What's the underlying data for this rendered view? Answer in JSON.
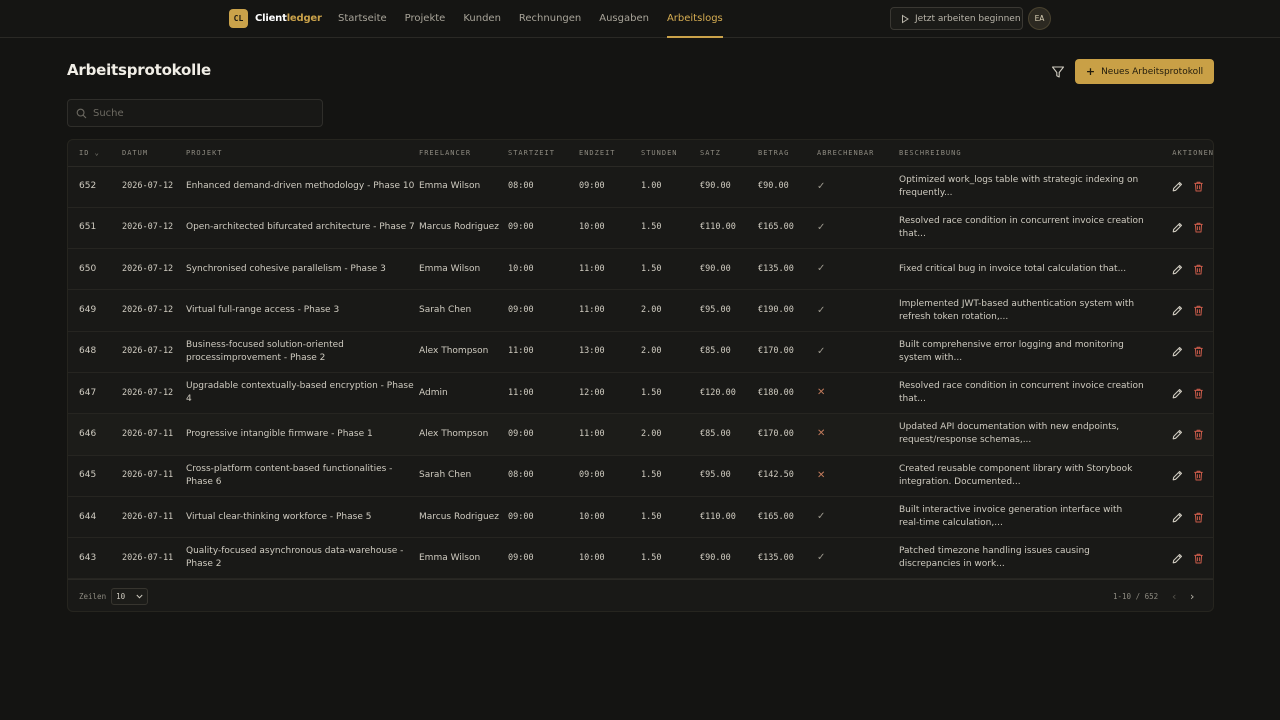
{
  "app": {
    "logo_mark": "CL",
    "name_part1": "Client",
    "name_part2": "ledger"
  },
  "nav": [
    "Startseite",
    "Projekte",
    "Kunden",
    "Rechnungen",
    "Ausgaben",
    "Arbeitslogs"
  ],
  "nav_active": "Arbeitslogs",
  "header": {
    "work_button": "Jetzt arbeiten beginnen",
    "avatar": "EA"
  },
  "page": {
    "title": "Arbeitsprotokolle",
    "new_button": "Neues Arbeitsprotokoll",
    "search_placeholder": "Suche"
  },
  "table": {
    "columns": [
      "ID",
      "DATUM",
      "PROJEKT",
      "FREELANCER",
      "STARTZEIT",
      "ENDZEIT",
      "STUNDEN",
      "SATZ",
      "BETRAG",
      "ABRECHENBAR",
      "BESCHREIBUNG",
      "AKTIONEN"
    ],
    "rows": [
      {
        "id": "652",
        "date": "2026-07-12",
        "project": "Enhanced demand-driven methodology - Phase 10",
        "freelancer": "Emma Wilson",
        "start": "08:00",
        "end": "09:00",
        "hours": "1.00",
        "rate": "€90.00",
        "amount": "€90.00",
        "billable": true,
        "description": "Optimized work_logs table with strategic indexing on frequently..."
      },
      {
        "id": "651",
        "date": "2026-07-12",
        "project": "Open-architected bifurcated architecture - Phase 7",
        "freelancer": "Marcus Rodriguez",
        "start": "09:00",
        "end": "10:00",
        "hours": "1.50",
        "rate": "€110.00",
        "amount": "€165.00",
        "billable": true,
        "description": "Resolved race condition in concurrent invoice creation that..."
      },
      {
        "id": "650",
        "date": "2026-07-12",
        "project": "Synchronised cohesive parallelism - Phase 3",
        "freelancer": "Emma Wilson",
        "start": "10:00",
        "end": "11:00",
        "hours": "1.50",
        "rate": "€90.00",
        "amount": "€135.00",
        "billable": true,
        "description": "Fixed critical bug in invoice total calculation that..."
      },
      {
        "id": "649",
        "date": "2026-07-12",
        "project": "Virtual full-range access - Phase 3",
        "freelancer": "Sarah Chen",
        "start": "09:00",
        "end": "11:00",
        "hours": "2.00",
        "rate": "€95.00",
        "amount": "€190.00",
        "billable": true,
        "description": "Implemented JWT-based authentication system with refresh token rotation,..."
      },
      {
        "id": "648",
        "date": "2026-07-12",
        "project": "Business-focused solution-oriented processimprovement - Phase 2",
        "freelancer": "Alex Thompson",
        "start": "11:00",
        "end": "13:00",
        "hours": "2.00",
        "rate": "€85.00",
        "amount": "€170.00",
        "billable": true,
        "description": "Built comprehensive error logging and monitoring system with..."
      },
      {
        "id": "647",
        "date": "2026-07-12",
        "project": "Upgradable contextually-based encryption - Phase 4",
        "freelancer": "Admin",
        "start": "11:00",
        "end": "12:00",
        "hours": "1.50",
        "rate": "€120.00",
        "amount": "€180.00",
        "billable": false,
        "description": "Resolved race condition in concurrent invoice creation that..."
      },
      {
        "id": "646",
        "date": "2026-07-11",
        "project": "Progressive intangible firmware - Phase 1",
        "freelancer": "Alex Thompson",
        "start": "09:00",
        "end": "11:00",
        "hours": "2.00",
        "rate": "€85.00",
        "amount": "€170.00",
        "billable": false,
        "description": "Updated API documentation with new endpoints, request/response schemas,..."
      },
      {
        "id": "645",
        "date": "2026-07-11",
        "project": "Cross-platform content-based functionalities - Phase 6",
        "freelancer": "Sarah Chen",
        "start": "08:00",
        "end": "09:00",
        "hours": "1.50",
        "rate": "€95.00",
        "amount": "€142.50",
        "billable": false,
        "description": "Created reusable component library with Storybook integration. Documented..."
      },
      {
        "id": "644",
        "date": "2026-07-11",
        "project": "Virtual clear-thinking workforce - Phase 5",
        "freelancer": "Marcus Rodriguez",
        "start": "09:00",
        "end": "10:00",
        "hours": "1.50",
        "rate": "€110.00",
        "amount": "€165.00",
        "billable": true,
        "description": "Built interactive invoice generation interface with real-time calculation,..."
      },
      {
        "id": "643",
        "date": "2026-07-11",
        "project": "Quality-focused asynchronous data-warehouse - Phase 2",
        "freelancer": "Emma Wilson",
        "start": "09:00",
        "end": "10:00",
        "hours": "1.50",
        "rate": "€90.00",
        "amount": "€135.00",
        "billable": true,
        "description": "Patched timezone handling issues causing discrepancies in work..."
      }
    ]
  },
  "footer": {
    "rows_label": "Zeilen",
    "rows_value": "10",
    "page_info": "1-10 / 652"
  },
  "colors": {
    "accent": "#c9a046",
    "background": "#141412",
    "not_billable": "#c37b5c"
  }
}
